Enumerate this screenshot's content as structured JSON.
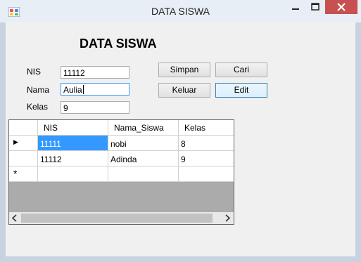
{
  "window": {
    "title": "DATA SISWA"
  },
  "form": {
    "heading": "DATA SISWA",
    "labels": {
      "nis": "NIS",
      "nama": "Nama",
      "kelas": "Kelas"
    },
    "values": {
      "nis": "11112",
      "nama": "Aulia",
      "kelas": "9"
    },
    "buttons": {
      "simpan": "Simpan",
      "cari": "Cari",
      "keluar": "Keluar",
      "edit": "Edit"
    }
  },
  "grid": {
    "columns": [
      "NIS",
      "Nama_Siswa",
      "Kelas"
    ],
    "rows": [
      {
        "nis": "11111",
        "nama": "nobi",
        "kelas": "8"
      },
      {
        "nis": "11112",
        "nama": "Adinda",
        "kelas": "9"
      }
    ],
    "new_row_marker": "*",
    "current_row_marker": "▶"
  }
}
